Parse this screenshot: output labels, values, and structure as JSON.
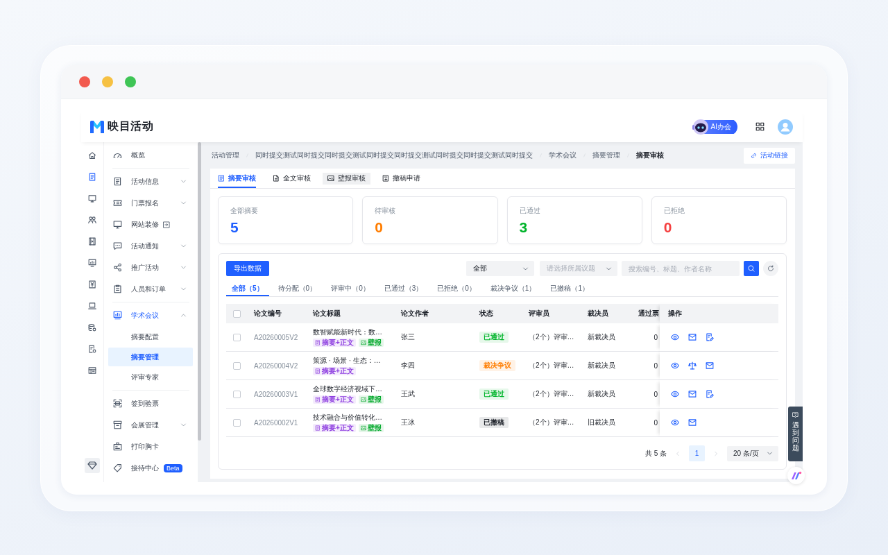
{
  "window": {
    "traffic_lights": [
      {
        "color": "#f25a4f"
      },
      {
        "color": "#f6c143"
      },
      {
        "color": "#3fc556"
      }
    ]
  },
  "header": {
    "logo": "映目活动",
    "ai_button": "AI办会"
  },
  "icon_rail": [
    {
      "selected": false
    },
    {
      "selected": true
    },
    {
      "selected": false
    },
    {
      "selected": false
    },
    {
      "selected": false
    },
    {
      "selected": false
    },
    {
      "selected": false
    },
    {
      "selected": false
    },
    {
      "selected": false
    },
    {
      "selected": false
    },
    {
      "selected": false
    }
  ],
  "menu": {
    "groups": [
      {
        "items": [
          {
            "label": "概览",
            "selected": false
          }
        ]
      },
      {
        "items": [
          {
            "label": "活动信息",
            "selected": false,
            "expanded": false
          },
          {
            "label": "门票报名",
            "selected": false,
            "expanded": false
          },
          {
            "label": "网站装修",
            "selected": false,
            "external": true
          },
          {
            "label": "活动通知",
            "selected": false,
            "expanded": false
          },
          {
            "label": "推广活动",
            "selected": false,
            "expanded": false
          },
          {
            "label": "人员和订单",
            "selected": false,
            "expanded": false
          }
        ]
      },
      {
        "items": [
          {
            "label": "学术会议",
            "selected": true,
            "expanded": true,
            "children": [
              {
                "label": "摘要配置",
                "selected": false
              },
              {
                "label": "摘要管理",
                "selected": true
              },
              {
                "label": "评审专家",
                "selected": false
              }
            ]
          }
        ]
      },
      {
        "items": [
          {
            "label": "签到验票",
            "selected": false
          },
          {
            "label": "会展管理",
            "selected": false,
            "expanded": false
          },
          {
            "label": "打印胸卡",
            "selected": false
          },
          {
            "label": "接待中心",
            "selected": false,
            "badge": "Beta"
          }
        ]
      }
    ]
  },
  "breadcrumb": [
    "活动管理",
    "同时提交测试同时提交同时提交测试同时提交同时提交测试同时提交同时提交测试同时提交",
    "学术会议",
    "摘要管理",
    "摘要审核"
  ],
  "link_button": "活动链接",
  "tabs": [
    {
      "label": "摘要审核",
      "selected": true,
      "hovered": false
    },
    {
      "label": "全文审核",
      "selected": false,
      "hovered": false
    },
    {
      "label": "壁报审核",
      "selected": false,
      "hovered": true
    },
    {
      "label": "撤稿申请",
      "selected": false,
      "hovered": false
    }
  ],
  "stats": [
    {
      "label": "全部摘要",
      "value": "5",
      "color": "#1f5fff"
    },
    {
      "label": "待审核",
      "value": "0",
      "color": "#ff7d00"
    },
    {
      "label": "已通过",
      "value": "3",
      "color": "#00b42a"
    },
    {
      "label": "已拒绝",
      "value": "0",
      "color": "#f53f3f"
    }
  ],
  "toolbar": {
    "export_button": "导出数据",
    "status_select": {
      "value": "全部"
    },
    "topic_select": {
      "placeholder": "请选择所属议题"
    },
    "search": {
      "placeholder": "搜索编号、标题、作者名称"
    }
  },
  "filters": [
    {
      "label": "全部（5）",
      "selected": true
    },
    {
      "label": "待分配（0）",
      "selected": false
    },
    {
      "label": "评审中（0）",
      "selected": false
    },
    {
      "label": "已通过（3）",
      "selected": false
    },
    {
      "label": "已拒绝（0）",
      "selected": false
    },
    {
      "label": "裁决争议（1）",
      "selected": false
    },
    {
      "label": "已撤稿（1）",
      "selected": false
    }
  ],
  "table": {
    "header_checkbox": {
      "checked": false
    },
    "columns": [
      "论文编号",
      "论文标题",
      "论文作者",
      "状态",
      "评审员",
      "裁决员",
      "通过票",
      "操作"
    ],
    "rows": [
      {
        "checked": false,
        "id": "A20260005V2",
        "title": "数智赋能新时代：数…",
        "tags": [
          {
            "label": "摘要+正文",
            "color": "#8e3fe0",
            "kind": "doc"
          },
          {
            "label": "壁报",
            "color": "#00a82a",
            "kind": "image"
          }
        ],
        "author": "张三",
        "status": {
          "label": "已通过",
          "color": "#00b42a"
        },
        "reviewers": "（2个）评审…",
        "arbiter": "新裁决员",
        "votes": "0",
        "actions": [
          {
            "kind": "view"
          },
          {
            "kind": "mail"
          },
          {
            "kind": "review"
          }
        ]
      },
      {
        "checked": false,
        "id": "A20260004V2",
        "title": "策源 · 场景 · 生态：…",
        "tags": [
          {
            "label": "摘要+正文",
            "color": "#8e3fe0",
            "kind": "doc"
          }
        ],
        "author": "李四",
        "status": {
          "label": "裁决争议",
          "color": "#ff7d00"
        },
        "reviewers": "（2个）评审…",
        "arbiter": "新裁决员",
        "votes": "0",
        "actions": [
          {
            "kind": "view"
          },
          {
            "kind": "arbitrate"
          },
          {
            "kind": "mail"
          }
        ]
      },
      {
        "checked": false,
        "id": "A20260003V1",
        "title": "全球数字经济视域下…",
        "tags": [
          {
            "label": "摘要+正文",
            "color": "#8e3fe0",
            "kind": "doc"
          },
          {
            "label": "壁报",
            "color": "#00a82a",
            "kind": "image"
          }
        ],
        "author": "王武",
        "status": {
          "label": "已通过",
          "color": "#00b42a"
        },
        "reviewers": "（2个）评审…",
        "arbiter": "新裁决员",
        "votes": "0",
        "actions": [
          {
            "kind": "view"
          },
          {
            "kind": "mail"
          },
          {
            "kind": "review"
          }
        ]
      },
      {
        "checked": false,
        "id": "A20260002V1",
        "title": "技术融合与价值转化…",
        "tags": [
          {
            "label": "摘要+正文",
            "color": "#8e3fe0",
            "kind": "doc"
          },
          {
            "label": "壁报",
            "color": "#00a82a",
            "kind": "image"
          }
        ],
        "author": "王冰",
        "status": {
          "label": "已撤稿",
          "color": "#1d2129"
        },
        "reviewers": "（2个）评审…",
        "arbiter": "旧裁决员",
        "votes": "0",
        "actions": [
          {
            "kind": "view"
          },
          {
            "kind": "mail"
          }
        ]
      }
    ]
  },
  "pagination": {
    "total": "共 5 条",
    "prev": {
      "disabled": true
    },
    "pages": [
      {
        "label": "1",
        "selected": true
      }
    ],
    "next": {
      "disabled": true
    },
    "page_size": "20 条/页"
  },
  "help_tab": "遇到问题"
}
